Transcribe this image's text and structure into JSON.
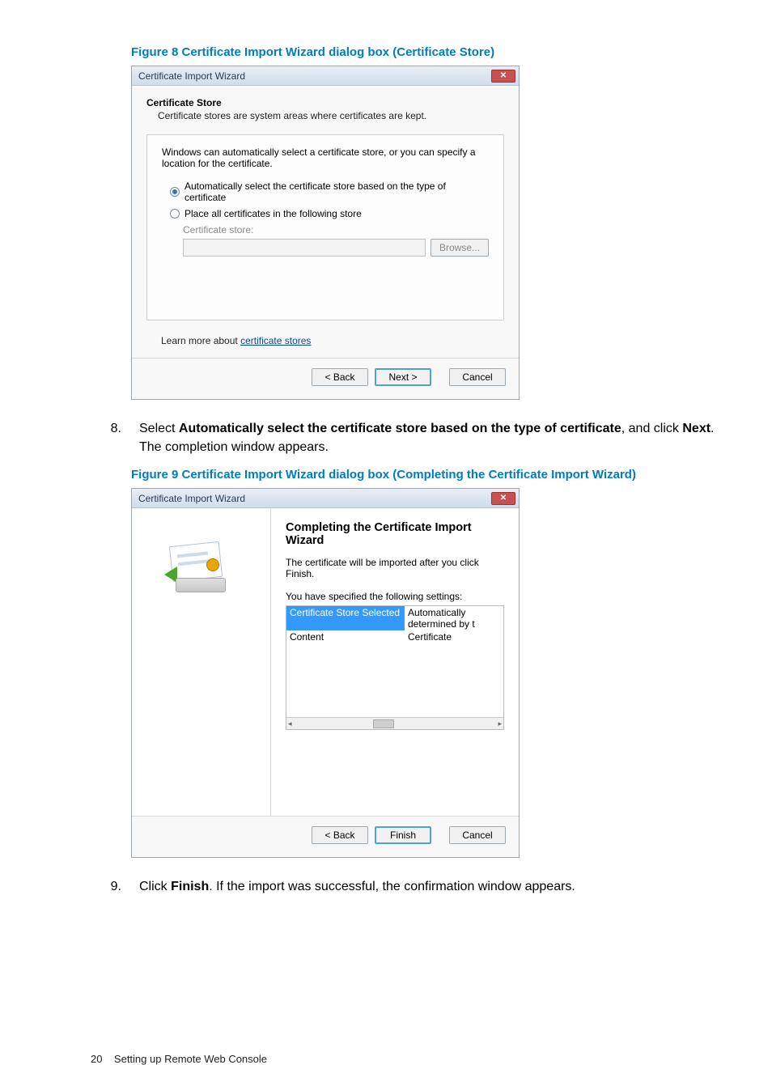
{
  "figure8": {
    "caption": "Figure 8 Certificate Import Wizard dialog box (Certificate Store)",
    "dialog_title": "Certificate Import Wizard",
    "section_heading": "Certificate Store",
    "section_sub": "Certificate stores are system areas where certificates are kept.",
    "intro_text": "Windows can automatically select a certificate store, or you can specify a location for the certificate.",
    "radio_auto": "Automatically select the certificate store based on the type of certificate",
    "radio_place": "Place all certificates in the following store",
    "store_label": "Certificate store:",
    "browse_btn": "Browse...",
    "learn_prefix": "Learn more about ",
    "learn_link": "certificate stores",
    "btn_back": "< Back",
    "btn_next": "Next >",
    "btn_cancel": "Cancel"
  },
  "step8": {
    "number": "8.",
    "text_pre": "Select ",
    "bold1": "Automatically select the certificate store based on the type of certificate",
    "text_mid": ", and click ",
    "bold2": "Next",
    "text_after": ". The completion window appears."
  },
  "figure9": {
    "caption": "Figure 9 Certificate Import Wizard dialog box (Completing the Certificate Import Wizard)",
    "dialog_title": "Certificate Import Wizard",
    "heading": "Completing the Certificate Import Wizard",
    "line1": "The certificate will be imported after you click Finish.",
    "line2": "You have specified the following settings:",
    "list": {
      "row1_key": "Certificate Store Selected",
      "row1_val": "Automatically determined by t",
      "row2_key": "Content",
      "row2_val": "Certificate"
    },
    "btn_back": "< Back",
    "btn_finish": "Finish",
    "btn_cancel": "Cancel"
  },
  "step9": {
    "number": "9.",
    "pre": "Click ",
    "bold": "Finish",
    "post": ". If the import was successful, the confirmation window appears."
  },
  "footer": {
    "page_num": "20",
    "section": "Setting up Remote Web Console"
  }
}
